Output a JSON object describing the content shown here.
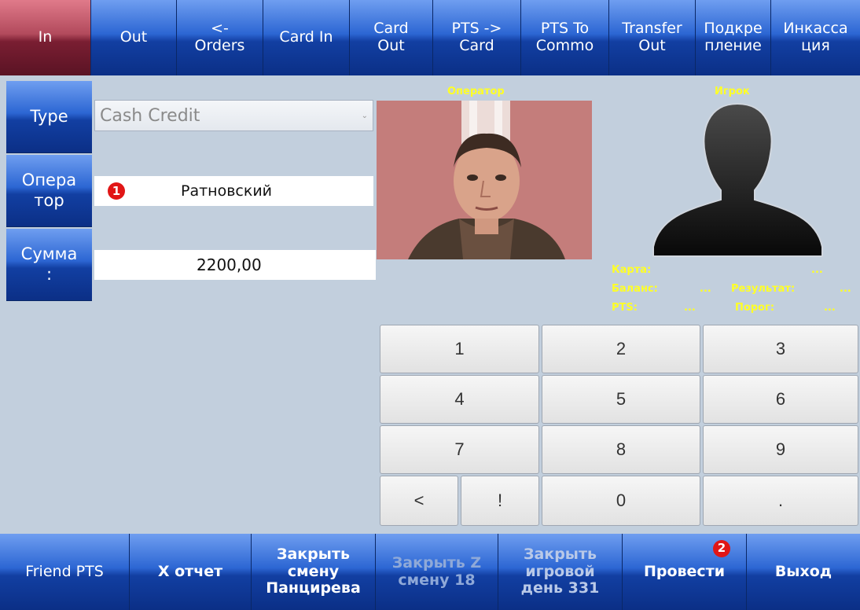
{
  "top_tabs": [
    {
      "label": "In",
      "active": true
    },
    {
      "label": "Out"
    },
    {
      "label": "<-\nOrders"
    },
    {
      "label": "Card In"
    },
    {
      "label": "Card\nOut"
    },
    {
      "label": "PTS ->\nCard"
    },
    {
      "label": "PTS To\nCommo"
    },
    {
      "label": "Transfer\nOut"
    },
    {
      "label": "Подкре\nпление"
    },
    {
      "label": "Инкасса\nция"
    }
  ],
  "form": {
    "type_label": "Type",
    "type_value": "Cash Credit",
    "operator_label": "Опера\nтор",
    "operator_value": "Ратновский",
    "operator_badge": "1",
    "sum_label": "Сумма\n:",
    "sum_value": "2200,00"
  },
  "operator_panel": {
    "title": "Оператор"
  },
  "player_panel": {
    "title": "Игрок",
    "card_label": "Карта:",
    "card_value": "...",
    "balance_label": "Баланс:",
    "balance_value": "...",
    "result_label": "Результат:",
    "result_value": "...",
    "pts_label": "PTS:",
    "pts_value": "...",
    "threshold_label": "Порог:",
    "threshold_value": "..."
  },
  "keypad": {
    "k1": "1",
    "k2": "2",
    "k3": "3",
    "k4": "4",
    "k5": "5",
    "k6": "6",
    "k7": "7",
    "k8": "8",
    "k9": "9",
    "back": "<",
    "bang": "!",
    "k0": "0",
    "dot": "."
  },
  "bottom_bar": [
    {
      "label": "Friend PTS"
    },
    {
      "label": "X отчет"
    },
    {
      "label": "Закрыть\nсмену\nПанцирева"
    },
    {
      "label": "Закрыть Z\nсмену 18",
      "disabled": true
    },
    {
      "label": "Закрыть\nигровой\nдень 331",
      "disabled_partial": true
    },
    {
      "label": "Провести",
      "badge": "2"
    },
    {
      "label": "Выход"
    }
  ],
  "colors": {
    "background": "#c2cfdd",
    "accent_blue": "#123fa2",
    "active_tab": "#7a1e32",
    "label_yellow": "#ffff26",
    "badge_red": "#e11616"
  }
}
